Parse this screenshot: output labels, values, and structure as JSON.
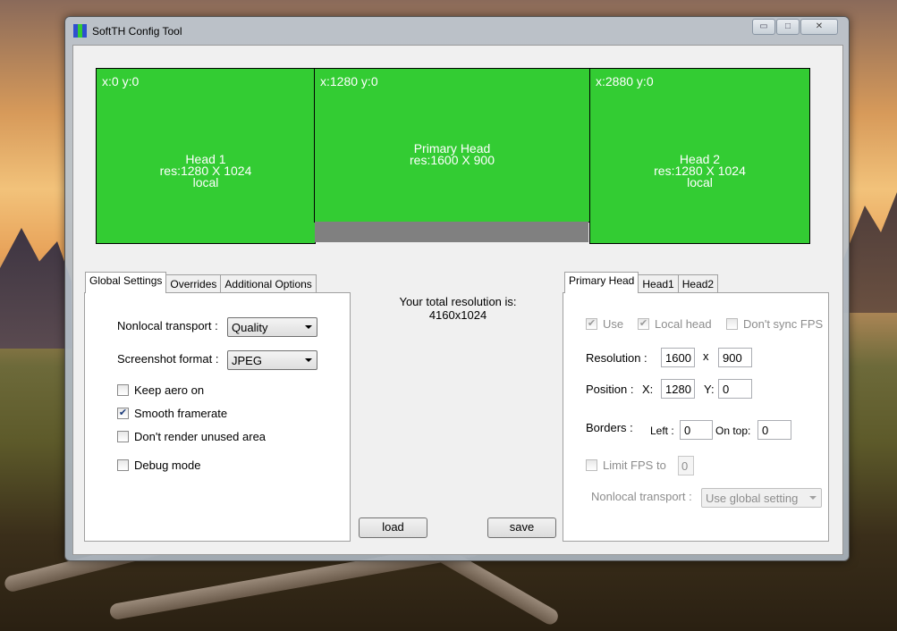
{
  "window": {
    "title": "SoftTH Config Tool",
    "icon_colors": [
      "#2f4fd0",
      "#33cc33",
      "#2f4fd0"
    ],
    "controls": {
      "minimize": "▭",
      "maximize": "□",
      "close": "✕"
    }
  },
  "layout_preview": {
    "fill_color": "#33cc33",
    "heads": [
      {
        "coord": "x:0 y:0",
        "lines": [
          "Head 1",
          "res:1280 X 1024",
          "local"
        ]
      },
      {
        "coord": "x:1280 y:0",
        "lines": [
          "Primary Head",
          "res:1600 X 900"
        ]
      },
      {
        "coord": "x:2880 y:0",
        "lines": [
          "Head 2",
          "res:1280 X 1024",
          "local"
        ]
      }
    ]
  },
  "left_tabs": {
    "tabs": [
      "Global Settings",
      "Overrides",
      "Additional Options"
    ],
    "active": 0,
    "nonlocal_transport_label": "Nonlocal transport :",
    "nonlocal_transport_value": "Quality",
    "screenshot_format_label": "Screenshot format :",
    "screenshot_format_value": "JPEG",
    "checkboxes": [
      {
        "label": "Keep aero on",
        "checked": false
      },
      {
        "label": "Smooth framerate",
        "checked": true
      },
      {
        "label": "Don't render unused area",
        "checked": false
      },
      {
        "label": "Debug mode",
        "checked": false
      }
    ]
  },
  "center": {
    "total_label": "Your total resolution is:",
    "total_value": "4160x1024",
    "load_label": "load",
    "save_label": "save"
  },
  "right_tabs": {
    "tabs": [
      "Primary Head",
      "Head1",
      "Head2"
    ],
    "active": 0,
    "use_label": "Use",
    "local_head_label": "Local head",
    "dont_sync_label": "Don't sync FPS",
    "resolution_label": "Resolution :",
    "res_w": "1600",
    "res_x_sep": "x",
    "res_h": "900",
    "position_label": "Position :",
    "pos_x_label": "X:",
    "pos_x": "1280",
    "pos_y_label": "Y:",
    "pos_y": "0",
    "borders_label": "Borders :",
    "left_label": "Left :",
    "left_value": "0",
    "ontop_label": "On top:",
    "ontop_value": "0",
    "limit_fps_label": "Limit FPS to",
    "limit_fps_value": "0",
    "nonlocal_label": "Nonlocal transport :",
    "nonlocal_value": "Use global setting"
  }
}
